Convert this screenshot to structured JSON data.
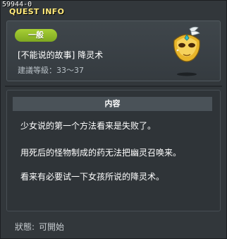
{
  "window": {
    "quest_id": "59944-0",
    "title": "QUEST INFO"
  },
  "quest": {
    "category": "一般",
    "name": "[不能说的故事] 降灵术",
    "level_label": "建議等級：",
    "level_range": "33～37",
    "icon": "golden-mask-icon"
  },
  "content": {
    "header": "内容",
    "lines": [
      "少女说的第一个方法看来是失败了。",
      "用死后的怪物制成的药无法把幽灵召唤来。",
      "看来有必要试一下女孩所说的降灵术。"
    ]
  },
  "status": {
    "label": "狀態:",
    "value": "可開始"
  },
  "colors": {
    "title": "#ffe97a",
    "badge": "#8fbd2a",
    "background": "#32373b"
  }
}
